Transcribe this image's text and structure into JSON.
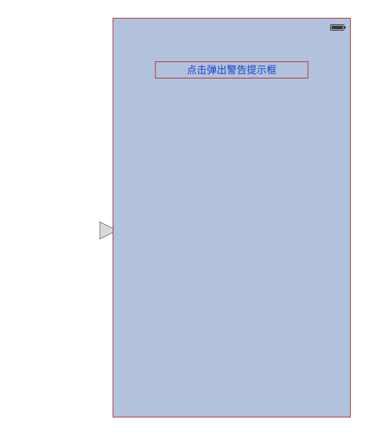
{
  "device": {
    "alert_button_label": "点击弹出警告提示框"
  }
}
